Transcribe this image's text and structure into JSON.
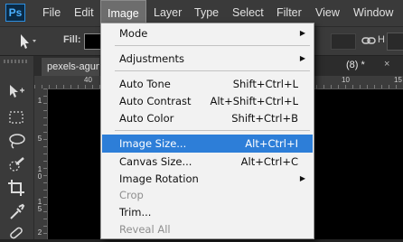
{
  "app": {
    "logo": "Ps"
  },
  "menubar": {
    "items": [
      {
        "label": "File"
      },
      {
        "label": "Edit"
      },
      {
        "label": "Image"
      },
      {
        "label": "Layer"
      },
      {
        "label": "Type"
      },
      {
        "label": "Select"
      },
      {
        "label": "Filter"
      },
      {
        "label": "View"
      },
      {
        "label": "Window"
      }
    ]
  },
  "options": {
    "fill_label": "Fill:",
    "fill_color": "#000000",
    "height_label": "H"
  },
  "document": {
    "tab_title": "pexels-agun",
    "tab2_title": "(8) *",
    "tab2_close": "×",
    "ruler_top": [
      "40",
      "10",
      "15"
    ],
    "ruler_left": [
      "1",
      "5",
      "1 0",
      "1 5",
      "2"
    ]
  },
  "image_menu": {
    "items": [
      {
        "label": "Mode",
        "shortcut": "",
        "submenu": true
      },
      {
        "label": "Adjustments",
        "shortcut": "",
        "submenu": true
      },
      {
        "label": "Auto Tone",
        "shortcut": "Shift+Ctrl+L"
      },
      {
        "label": "Auto Contrast",
        "shortcut": "Alt+Shift+Ctrl+L"
      },
      {
        "label": "Auto Color",
        "shortcut": "Shift+Ctrl+B"
      },
      {
        "label": "Image Size...",
        "shortcut": "Alt+Ctrl+I",
        "highlighted": true
      },
      {
        "label": "Canvas Size...",
        "shortcut": "Alt+Ctrl+C"
      },
      {
        "label": "Image Rotation",
        "shortcut": "",
        "submenu": true
      },
      {
        "label": "Crop",
        "shortcut": "",
        "disabled": true
      },
      {
        "label": "Trim...",
        "shortcut": ""
      },
      {
        "label": "Reveal All",
        "shortcut": "",
        "disabled": true
      }
    ],
    "submenu_arrow": "▶"
  },
  "colors": {
    "highlight": "#2d7ed8",
    "menubar": "#3a3a3a",
    "canvas": "#000000"
  }
}
